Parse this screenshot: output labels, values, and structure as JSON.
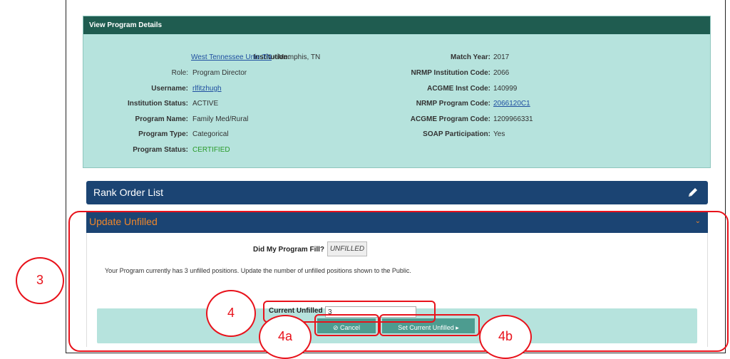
{
  "details": {
    "header": "View Program Details",
    "left": [
      {
        "label": "Institution:",
        "value": "West Tennessee Univ-TN",
        "suffix": " - Memphis, TN"
      },
      {
        "label": "Role:",
        "value": "Program Director"
      },
      {
        "label": "Username:",
        "value": "rlfitzhugh"
      },
      {
        "label": "Institution Status:",
        "value": "ACTIVE"
      },
      {
        "label": "Program Name:",
        "value": "Family Med/Rural"
      },
      {
        "label": "Program Type:",
        "value": "Categorical"
      },
      {
        "label": "Program Status:",
        "value": "CERTIFIED"
      }
    ],
    "right": [
      {
        "label": "Match Year:",
        "value": "2017"
      },
      {
        "label": "NRMP Institution Code:",
        "value": "2066"
      },
      {
        "label": "ACGME Inst Code:",
        "value": "140999"
      },
      {
        "label": "NRMP Program Code:",
        "value": "2066120C1"
      },
      {
        "label": "ACGME Program Code:",
        "value": "1209966331"
      },
      {
        "label": "SOAP Participation:",
        "value": "Yes"
      }
    ]
  },
  "rank_order": {
    "title": "Rank Order List",
    "icon": "pencil-icon"
  },
  "update_unfilled": {
    "title": "Update Unfilled",
    "fill_question": "Did My Program Fill?",
    "fill_status": "UNFILLED",
    "message": "Your Program currently has 3 unfilled positions. Update the number of unfilled positions shown to the Public.",
    "current_label": "Current Unfilled",
    "current_value": "3",
    "cancel_label": "⊘ Cancel",
    "set_label": "Set Current Unfilled ▸"
  },
  "annotations": {
    "step3": "3",
    "step4": "4",
    "step4a": "4a",
    "step4b": "4b",
    "color": "#e8121b"
  }
}
